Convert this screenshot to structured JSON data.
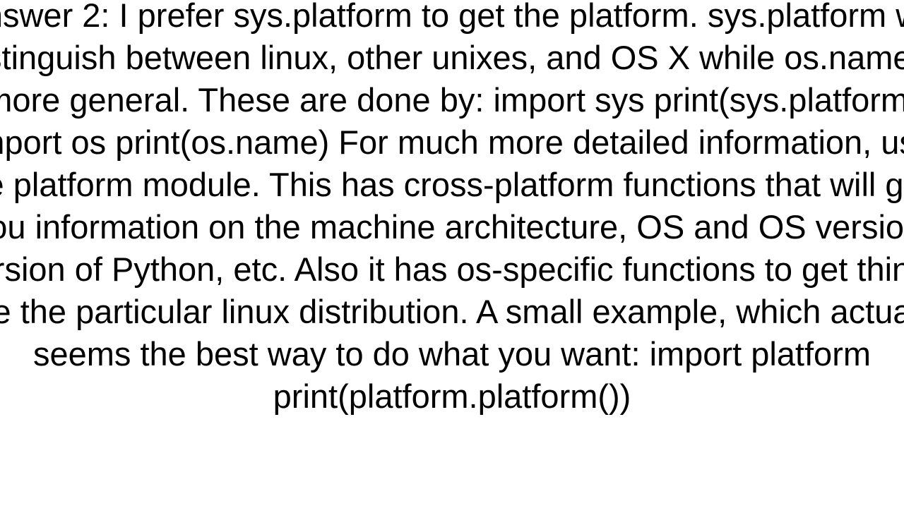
{
  "document": {
    "answer_text": "Answer 2: I prefer sys.platform to get the platform. sys.platform will distinguish between linux, other unixes, and OS X while os.name is more general. These are done by: import sys print(sys.platform)  import os print(os.name)  For much more detailed information, use the platform module. This has cross-platform functions that will give you information on the machine architecture, OS and OS version, version of Python, etc. Also it has os-specific functions to get things like the particular linux distribution. A small example, which actually seems the best way to do what you want: import platform print(platform.platform())"
  }
}
